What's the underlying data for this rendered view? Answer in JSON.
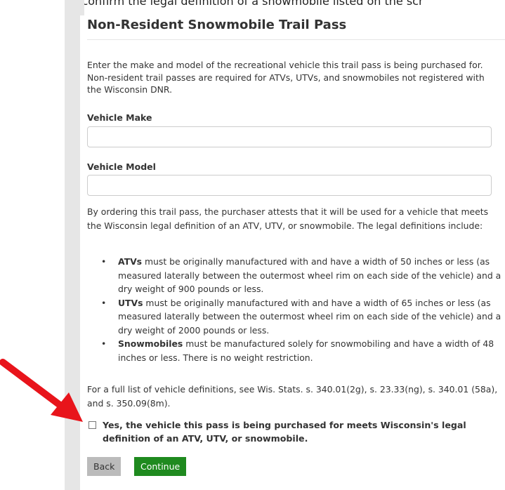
{
  "caption": "confirm the legal definition of a snowmobile listed on the scr",
  "form": {
    "title": "Non-Resident Snowmobile Trail Pass",
    "intro": "Enter the make and model of the recreational vehicle this trail pass is being purchased for. Non-resident trail passes are required for ATVs, UTVs, and snowmobiles not registered with the Wisconsin DNR.",
    "make_label": "Vehicle Make",
    "make_value": "",
    "model_label": "Vehicle Model",
    "model_value": "",
    "attest": "By ordering this trail pass, the purchaser attests that it will be used for a vehicle that meets the Wisconsin legal definition of an ATV, UTV, or snowmobile. The legal definitions include:",
    "definitions": [
      {
        "term": "ATVs",
        "text": " must be originally manufactured with and have a width of 50 inches or less (as measured laterally between the outermost wheel rim on each side of the vehicle) and a dry weight of 900 pounds or less."
      },
      {
        "term": "UTVs",
        "text": " must be originally manufactured with and have a width of 65 inches or less (as measured laterally between the outermost wheel rim on each side of the vehicle) and a dry weight of 2000 pounds or less."
      },
      {
        "term": "Snowmobiles",
        "text": " must be manufactured solely for snowmobiling and have a width of 48 inches or less. There is no weight restriction."
      }
    ],
    "full_list": "For a full list of vehicle definitions, see Wis. Stats. s. 340.01(2g), s. 23.33(ng), s. 340.01 (58a), and s. 350.09(8m).",
    "confirm_label": "Yes, the vehicle this pass is being purchased for meets Wisconsin's legal definition of an ATV, UTV, or snowmobile.",
    "confirm_checked": false,
    "back_label": "Back",
    "continue_label": "Continue"
  },
  "colors": {
    "continue_bg": "#1f8a1f",
    "back_bg": "#bbbbbb",
    "arrow": "#e8141b"
  },
  "icons": {
    "bullet": "•",
    "arrow": "red-pointer-arrow"
  }
}
